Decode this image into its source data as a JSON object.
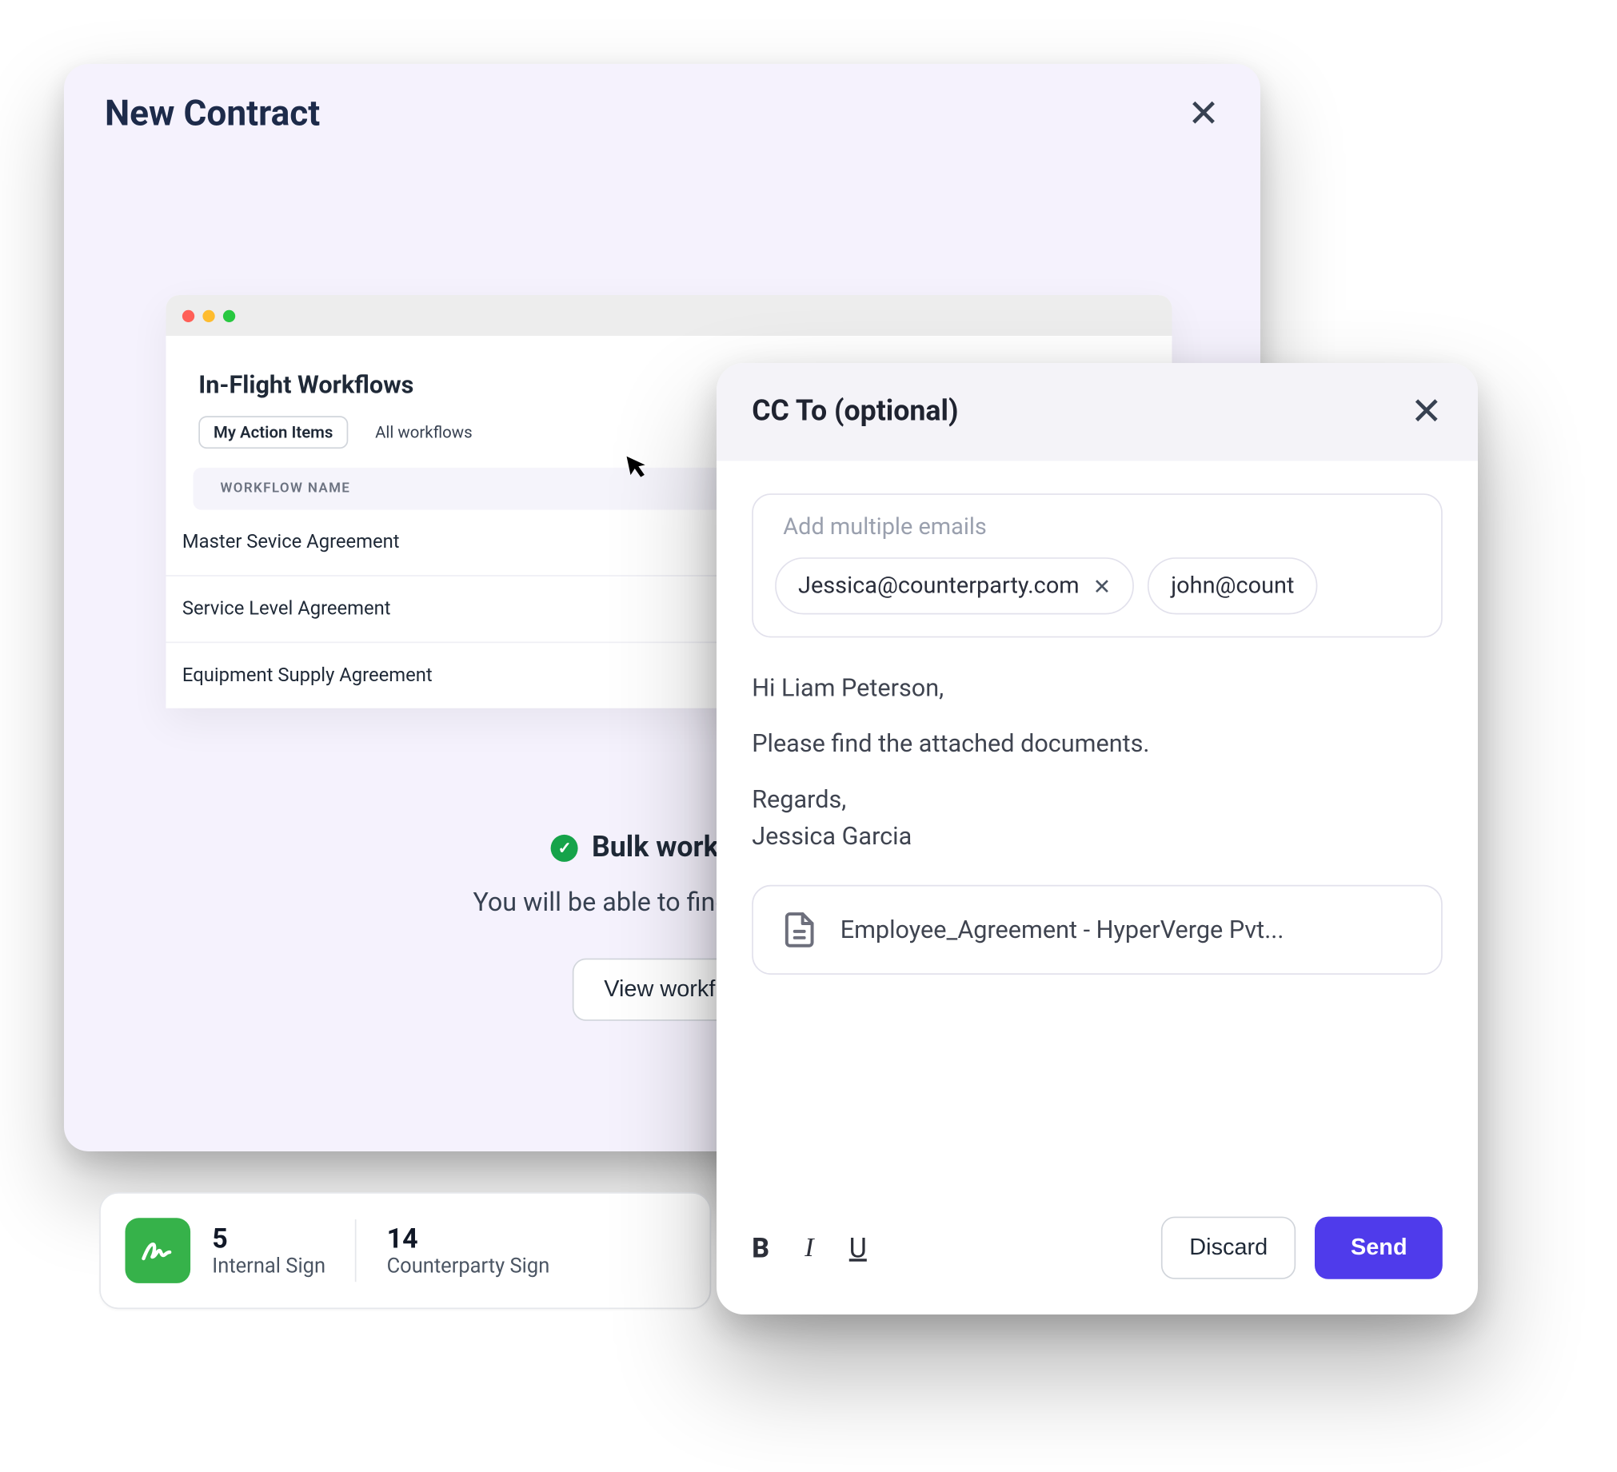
{
  "main": {
    "title": "New Contract",
    "close_aria": "Close"
  },
  "workflows": {
    "heading": "In-Flight Workflows",
    "tabs": {
      "active": "My Action Items",
      "all": "All workflows"
    },
    "column_header": "WORKFLOW NAME",
    "rows": [
      "Master Sevice Agreement",
      "Service Level Agreement",
      "Equipment Supply Agreement"
    ]
  },
  "success": {
    "title": "Bulk workflow",
    "subtitle": "You will be able to find them in th",
    "view_button": "View workfl"
  },
  "signbar": {
    "internal_count": "5",
    "internal_label": "Internal Sign",
    "counter_count": "14",
    "counter_label": "Counterparty Sign"
  },
  "email": {
    "title": "CC To (optional)",
    "placeholder": "Add multiple emails",
    "chips": [
      "Jessica@counterparty.com",
      "john@count"
    ],
    "body_greeting": "Hi Liam Peterson,",
    "body_line": "Please find the attached documents.",
    "body_regards1": "Regards,",
    "body_regards2": "Jessica Garcia",
    "attachment": "Employee_Agreement - HyperVerge Pvt...",
    "format": {
      "bold": "B",
      "italic": "I",
      "underline": "U"
    },
    "discard": "Discard",
    "send": "Send"
  }
}
